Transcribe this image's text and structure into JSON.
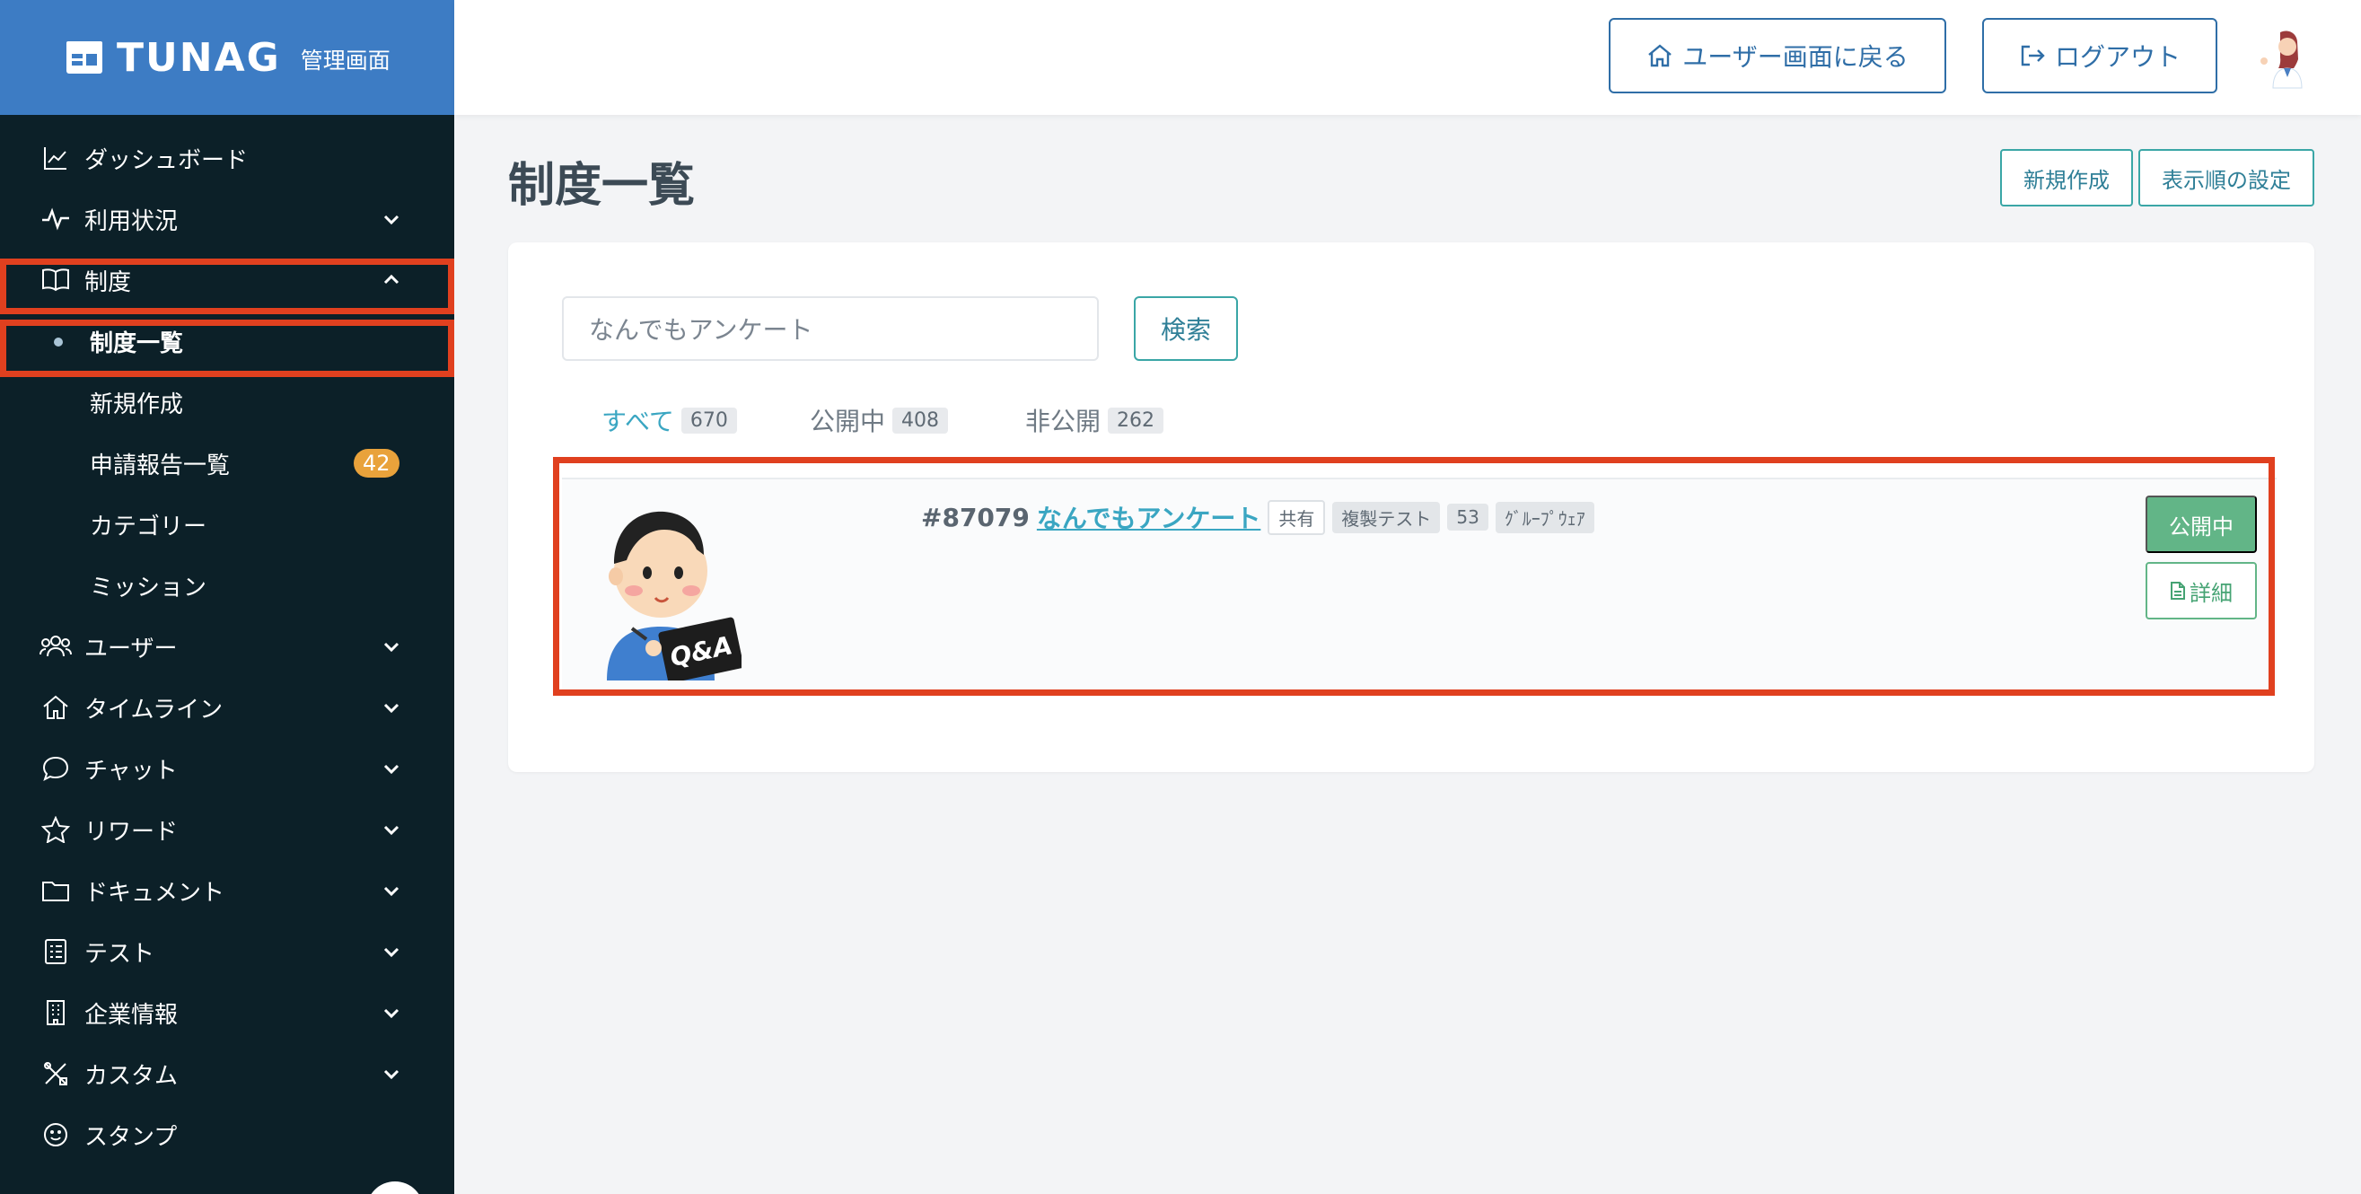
{
  "brand": {
    "name": "TUNAG",
    "subtitle": "管理画面"
  },
  "sidebar": {
    "items": [
      {
        "label": "ダッシュボード",
        "icon": "chart-line-icon",
        "expandable": false
      },
      {
        "label": "利用状況",
        "icon": "activity-icon",
        "expandable": true
      },
      {
        "label": "制度",
        "icon": "book-icon",
        "expandable": true,
        "expanded": true
      },
      {
        "label": "ユーザー",
        "icon": "users-icon",
        "expandable": true
      },
      {
        "label": "タイムライン",
        "icon": "home-icon",
        "expandable": true
      },
      {
        "label": "チャット",
        "icon": "chat-bubble-icon",
        "expandable": true
      },
      {
        "label": "リワード",
        "icon": "star-icon",
        "expandable": true
      },
      {
        "label": "ドキュメント",
        "icon": "folder-icon",
        "expandable": true
      },
      {
        "label": "テスト",
        "icon": "checklist-icon",
        "expandable": true
      },
      {
        "label": "企業情報",
        "icon": "building-icon",
        "expandable": true
      },
      {
        "label": "カスタム",
        "icon": "tools-icon",
        "expandable": true
      },
      {
        "label": "スタンプ",
        "icon": "smile-icon",
        "expandable": false
      }
    ],
    "subitems": [
      {
        "label": "制度一覧",
        "active": true
      },
      {
        "label": "新規作成"
      },
      {
        "label": "申請報告一覧",
        "count": "42"
      },
      {
        "label": "カテゴリー"
      },
      {
        "label": "ミッション"
      }
    ]
  },
  "topbar": {
    "back_label": "ユーザー画面に戻る",
    "logout_label": "ログアウト"
  },
  "page": {
    "title": "制度一覧",
    "new_label": "新規作成",
    "order_label": "表示順の設定"
  },
  "search": {
    "value": "なんでもアンケート",
    "button_label": "検索"
  },
  "tabs": [
    {
      "label": "すべて",
      "count": "670",
      "active": true
    },
    {
      "label": "公開中",
      "count": "408"
    },
    {
      "label": "非公開",
      "count": "262"
    }
  ],
  "rows": [
    {
      "id": "#87079",
      "name": "なんでもアンケート",
      "tags": [
        "共有",
        "複製テスト",
        "53",
        "ｸﾞﾙｰﾌﾟｳｪｱ"
      ],
      "status": "公開中",
      "detail_label": "詳細",
      "illustration_text": "Q&A"
    }
  ],
  "colors": {
    "sidebar_bg": "#0c2028",
    "brand_bg": "#3d7cc4",
    "highlight": "#e0401f",
    "accent": "#3aa6c2",
    "status_green": "#62b587"
  }
}
